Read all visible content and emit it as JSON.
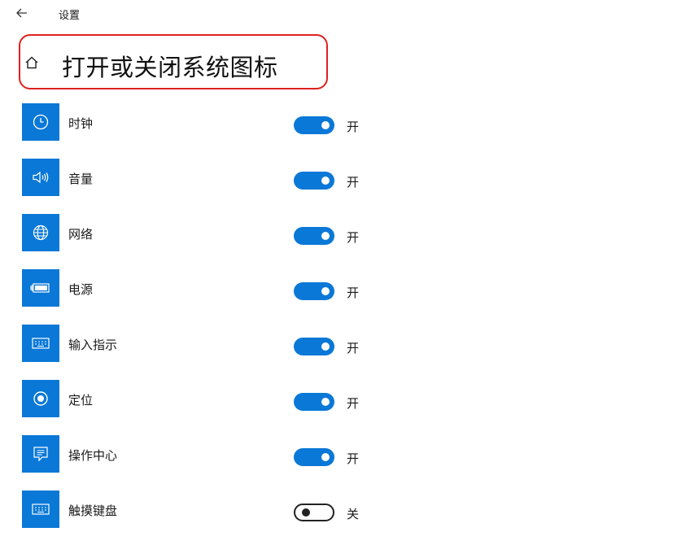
{
  "window": {
    "title": "设置"
  },
  "header": {
    "title": "打开或关闭系统图标",
    "highlight_color": "#e02020"
  },
  "accent": "#0a78d7",
  "items": [
    {
      "label": "时钟",
      "icon": "clock-icon",
      "on": true,
      "state": "开"
    },
    {
      "label": "音量",
      "icon": "volume-icon",
      "on": true,
      "state": "开"
    },
    {
      "label": "网络",
      "icon": "globe-icon",
      "on": true,
      "state": "开"
    },
    {
      "label": "电源",
      "icon": "battery-icon",
      "on": true,
      "state": "开"
    },
    {
      "label": "输入指示",
      "icon": "keyboard-icon",
      "on": true,
      "state": "开"
    },
    {
      "label": "定位",
      "icon": "location-icon",
      "on": true,
      "state": "开"
    },
    {
      "label": "操作中心",
      "icon": "action-center-icon",
      "on": true,
      "state": "开"
    },
    {
      "label": "触摸键盘",
      "icon": "keyboard-icon",
      "on": false,
      "state": "关"
    }
  ]
}
